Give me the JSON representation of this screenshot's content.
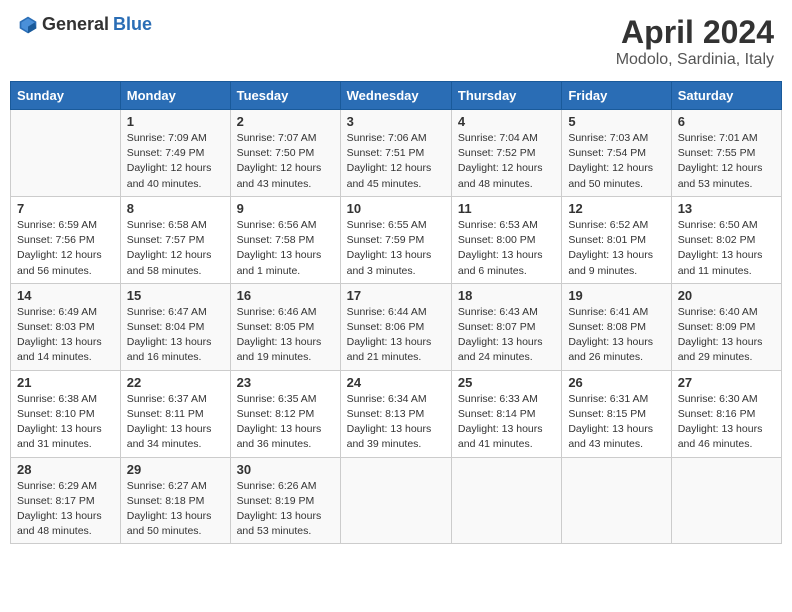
{
  "header": {
    "logo_general": "General",
    "logo_blue": "Blue",
    "month_year": "April 2024",
    "location": "Modolo, Sardinia, Italy"
  },
  "days_of_week": [
    "Sunday",
    "Monday",
    "Tuesday",
    "Wednesday",
    "Thursday",
    "Friday",
    "Saturday"
  ],
  "weeks": [
    [
      {
        "day": "",
        "sunrise": "",
        "sunset": "",
        "daylight": ""
      },
      {
        "day": "1",
        "sunrise": "Sunrise: 7:09 AM",
        "sunset": "Sunset: 7:49 PM",
        "daylight": "Daylight: 12 hours and 40 minutes."
      },
      {
        "day": "2",
        "sunrise": "Sunrise: 7:07 AM",
        "sunset": "Sunset: 7:50 PM",
        "daylight": "Daylight: 12 hours and 43 minutes."
      },
      {
        "day": "3",
        "sunrise": "Sunrise: 7:06 AM",
        "sunset": "Sunset: 7:51 PM",
        "daylight": "Daylight: 12 hours and 45 minutes."
      },
      {
        "day": "4",
        "sunrise": "Sunrise: 7:04 AM",
        "sunset": "Sunset: 7:52 PM",
        "daylight": "Daylight: 12 hours and 48 minutes."
      },
      {
        "day": "5",
        "sunrise": "Sunrise: 7:03 AM",
        "sunset": "Sunset: 7:54 PM",
        "daylight": "Daylight: 12 hours and 50 minutes."
      },
      {
        "day": "6",
        "sunrise": "Sunrise: 7:01 AM",
        "sunset": "Sunset: 7:55 PM",
        "daylight": "Daylight: 12 hours and 53 minutes."
      }
    ],
    [
      {
        "day": "7",
        "sunrise": "Sunrise: 6:59 AM",
        "sunset": "Sunset: 7:56 PM",
        "daylight": "Daylight: 12 hours and 56 minutes."
      },
      {
        "day": "8",
        "sunrise": "Sunrise: 6:58 AM",
        "sunset": "Sunset: 7:57 PM",
        "daylight": "Daylight: 12 hours and 58 minutes."
      },
      {
        "day": "9",
        "sunrise": "Sunrise: 6:56 AM",
        "sunset": "Sunset: 7:58 PM",
        "daylight": "Daylight: 13 hours and 1 minute."
      },
      {
        "day": "10",
        "sunrise": "Sunrise: 6:55 AM",
        "sunset": "Sunset: 7:59 PM",
        "daylight": "Daylight: 13 hours and 3 minutes."
      },
      {
        "day": "11",
        "sunrise": "Sunrise: 6:53 AM",
        "sunset": "Sunset: 8:00 PM",
        "daylight": "Daylight: 13 hours and 6 minutes."
      },
      {
        "day": "12",
        "sunrise": "Sunrise: 6:52 AM",
        "sunset": "Sunset: 8:01 PM",
        "daylight": "Daylight: 13 hours and 9 minutes."
      },
      {
        "day": "13",
        "sunrise": "Sunrise: 6:50 AM",
        "sunset": "Sunset: 8:02 PM",
        "daylight": "Daylight: 13 hours and 11 minutes."
      }
    ],
    [
      {
        "day": "14",
        "sunrise": "Sunrise: 6:49 AM",
        "sunset": "Sunset: 8:03 PM",
        "daylight": "Daylight: 13 hours and 14 minutes."
      },
      {
        "day": "15",
        "sunrise": "Sunrise: 6:47 AM",
        "sunset": "Sunset: 8:04 PM",
        "daylight": "Daylight: 13 hours and 16 minutes."
      },
      {
        "day": "16",
        "sunrise": "Sunrise: 6:46 AM",
        "sunset": "Sunset: 8:05 PM",
        "daylight": "Daylight: 13 hours and 19 minutes."
      },
      {
        "day": "17",
        "sunrise": "Sunrise: 6:44 AM",
        "sunset": "Sunset: 8:06 PM",
        "daylight": "Daylight: 13 hours and 21 minutes."
      },
      {
        "day": "18",
        "sunrise": "Sunrise: 6:43 AM",
        "sunset": "Sunset: 8:07 PM",
        "daylight": "Daylight: 13 hours and 24 minutes."
      },
      {
        "day": "19",
        "sunrise": "Sunrise: 6:41 AM",
        "sunset": "Sunset: 8:08 PM",
        "daylight": "Daylight: 13 hours and 26 minutes."
      },
      {
        "day": "20",
        "sunrise": "Sunrise: 6:40 AM",
        "sunset": "Sunset: 8:09 PM",
        "daylight": "Daylight: 13 hours and 29 minutes."
      }
    ],
    [
      {
        "day": "21",
        "sunrise": "Sunrise: 6:38 AM",
        "sunset": "Sunset: 8:10 PM",
        "daylight": "Daylight: 13 hours and 31 minutes."
      },
      {
        "day": "22",
        "sunrise": "Sunrise: 6:37 AM",
        "sunset": "Sunset: 8:11 PM",
        "daylight": "Daylight: 13 hours and 34 minutes."
      },
      {
        "day": "23",
        "sunrise": "Sunrise: 6:35 AM",
        "sunset": "Sunset: 8:12 PM",
        "daylight": "Daylight: 13 hours and 36 minutes."
      },
      {
        "day": "24",
        "sunrise": "Sunrise: 6:34 AM",
        "sunset": "Sunset: 8:13 PM",
        "daylight": "Daylight: 13 hours and 39 minutes."
      },
      {
        "day": "25",
        "sunrise": "Sunrise: 6:33 AM",
        "sunset": "Sunset: 8:14 PM",
        "daylight": "Daylight: 13 hours and 41 minutes."
      },
      {
        "day": "26",
        "sunrise": "Sunrise: 6:31 AM",
        "sunset": "Sunset: 8:15 PM",
        "daylight": "Daylight: 13 hours and 43 minutes."
      },
      {
        "day": "27",
        "sunrise": "Sunrise: 6:30 AM",
        "sunset": "Sunset: 8:16 PM",
        "daylight": "Daylight: 13 hours and 46 minutes."
      }
    ],
    [
      {
        "day": "28",
        "sunrise": "Sunrise: 6:29 AM",
        "sunset": "Sunset: 8:17 PM",
        "daylight": "Daylight: 13 hours and 48 minutes."
      },
      {
        "day": "29",
        "sunrise": "Sunrise: 6:27 AM",
        "sunset": "Sunset: 8:18 PM",
        "daylight": "Daylight: 13 hours and 50 minutes."
      },
      {
        "day": "30",
        "sunrise": "Sunrise: 6:26 AM",
        "sunset": "Sunset: 8:19 PM",
        "daylight": "Daylight: 13 hours and 53 minutes."
      },
      {
        "day": "",
        "sunrise": "",
        "sunset": "",
        "daylight": ""
      },
      {
        "day": "",
        "sunrise": "",
        "sunset": "",
        "daylight": ""
      },
      {
        "day": "",
        "sunrise": "",
        "sunset": "",
        "daylight": ""
      },
      {
        "day": "",
        "sunrise": "",
        "sunset": "",
        "daylight": ""
      }
    ]
  ]
}
